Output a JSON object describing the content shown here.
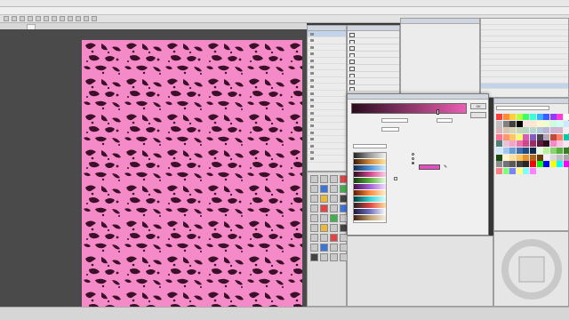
{
  "titlebar": {
    "title": ""
  },
  "menu": {
    "items": [
      "",
      "",
      "",
      "",
      "",
      "",
      "",
      "",
      "",
      "",
      "",
      ""
    ]
  },
  "document": {
    "tab_label": ""
  },
  "subtool_panel": {
    "title": "",
    "items": [
      "",
      "",
      "",
      "",
      "",
      "",
      "",
      "",
      "",
      "",
      "",
      "",
      "",
      "",
      "",
      "",
      "",
      "",
      "",
      ""
    ],
    "active_index": 0
  },
  "layer_panel": {
    "mode": "",
    "layers": [
      "",
      "",
      "",
      "",
      "",
      "",
      "",
      "",
      "",
      ""
    ]
  },
  "layer_property": {
    "title": "",
    "note": ""
  },
  "history_panel": {
    "rows": [
      "",
      "",
      "",
      "",
      "",
      "",
      "",
      "",
      "",
      "",
      "",
      ""
    ],
    "selected_index": 11
  },
  "gradient_dialog": {
    "title": "",
    "ok_label": "OK",
    "cancel_label": "",
    "blend_mode_label": "",
    "blend_mode_value": "",
    "opacity_label": "",
    "opacity_value": "",
    "position_label": "",
    "position_value": "",
    "preset_label": "",
    "preset_select": "",
    "main_color_label": "",
    "sub_color_label": "",
    "specified_color_label": "",
    "checkbox_label": "",
    "selected_stop_color": "#e44ec2",
    "gradient_start": "#2a0c1e",
    "gradient_end": "#ea5fb2"
  },
  "colorset": {
    "title": "",
    "select_value": "",
    "swatches": [
      "#ff3b3b",
      "#ff8a3b",
      "#ffd23b",
      "#b7ff3b",
      "#3bff64",
      "#3bffd8",
      "#3bb0ff",
      "#3b5cff",
      "#8c3bff",
      "#ff3bd3",
      "#ffffff",
      "#c0c0c0",
      "#808080",
      "#404040",
      "#000000",
      "#ffe0e0",
      "#ffe6cc",
      "#fff7cc",
      "#ecffcc",
      "#ccffd9",
      "#ccfff6",
      "#cceaff",
      "#d8b4b4",
      "#d8c6b4",
      "#d8d4b4",
      "#c7d8b4",
      "#b4d8bd",
      "#b4d8d2",
      "#b4c8d8",
      "#b8b4d8",
      "#cdb4d8",
      "#d8b4cb",
      "#f0f0f0",
      "#ff6f91",
      "#ff9671",
      "#ffc75f",
      "#f9f871",
      "#d65db1",
      "#845ec2",
      "#4b4453",
      "#b0a8b9",
      "#c34a36",
      "#ff8066",
      "#00c9a7",
      "#4d8076",
      "#e6c3d8",
      "#f5a3c7",
      "#ef6fb0",
      "#d2458d",
      "#9b2d65",
      "#5e1a3d",
      "#2d0c1e",
      "#f48ac7",
      "#ffc1e3",
      "#ffe5f2",
      "#d0e8ff",
      "#a0c8f0",
      "#6b9ed6",
      "#3e6fb0",
      "#214a80",
      "#10284a",
      "#e8ffe0",
      "#b8f0a0",
      "#86d66b",
      "#58b03e",
      "#347f22",
      "#1a4a10",
      "#fff3d0",
      "#ffe09a",
      "#ffc55c",
      "#e6952b",
      "#b0641a",
      "#6b3a0c",
      "#f2f2f2",
      "#d9d9d9",
      "#bfbfbf",
      "#a6a6a6",
      "#8c8c8c",
      "#737373",
      "#595959",
      "#404040",
      "#262626",
      "#ff0000",
      "#00ff00",
      "#0000ff",
      "#ffff00",
      "#00ffff",
      "#ff00ff",
      "#ff8080",
      "#80ff80",
      "#8080ff",
      "#ffff80",
      "#80ffff",
      "#ff80ff"
    ]
  },
  "statusbar": {
    "zoom": "",
    "info": ""
  }
}
